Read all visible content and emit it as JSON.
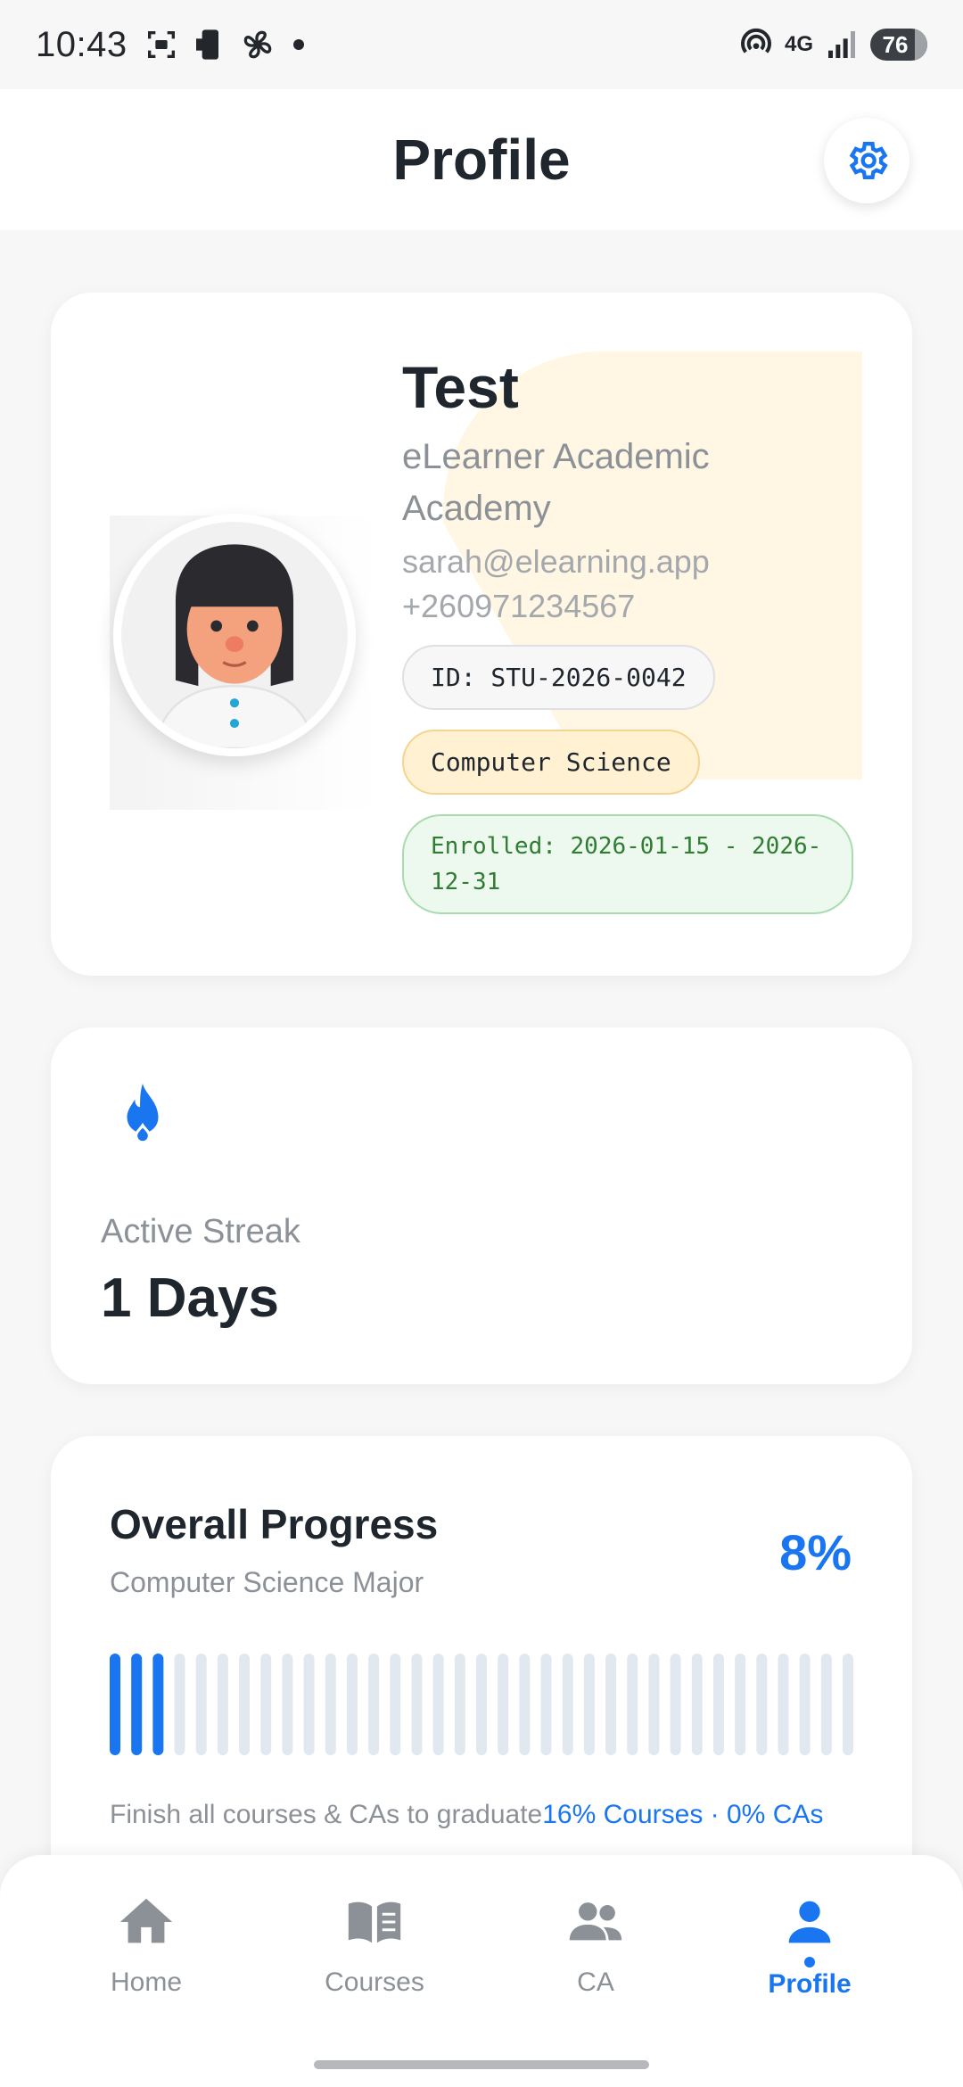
{
  "status_bar": {
    "time": "10:43",
    "network": "4G",
    "battery": "76"
  },
  "header": {
    "title": "Profile"
  },
  "profile": {
    "name": "Test",
    "school": "eLearner Academic Academy",
    "email": "sarah@elearning.app",
    "phone": "+260971234567",
    "student_id": "ID: STU-2026-0042",
    "major": "Computer Science",
    "enrolled": "Enrolled: 2026-01-15 - 2026-12-31"
  },
  "streak": {
    "label": "Active Streak",
    "value": "1 Days"
  },
  "progress": {
    "title": "Overall Progress",
    "subtitle": "Computer Science Major",
    "percent_label": "8%",
    "percent_value": 8,
    "total_segments": 35,
    "finish_text": "Finish all courses & CAs to graduate",
    "courses_text": "16% Courses",
    "cas_text": "· 0% CAs"
  },
  "nav": {
    "items": [
      {
        "label": "Home",
        "icon": "home-icon"
      },
      {
        "label": "Courses",
        "icon": "book-icon"
      },
      {
        "label": "CA",
        "icon": "people-icon"
      },
      {
        "label": "Profile",
        "icon": "person-icon"
      }
    ],
    "active": "Profile"
  },
  "colors": {
    "accent": "#1976f0",
    "major_pill": "#fff1d2",
    "enrolled_pill": "#edf8ee",
    "enrolled_text": "#2e7d32"
  }
}
